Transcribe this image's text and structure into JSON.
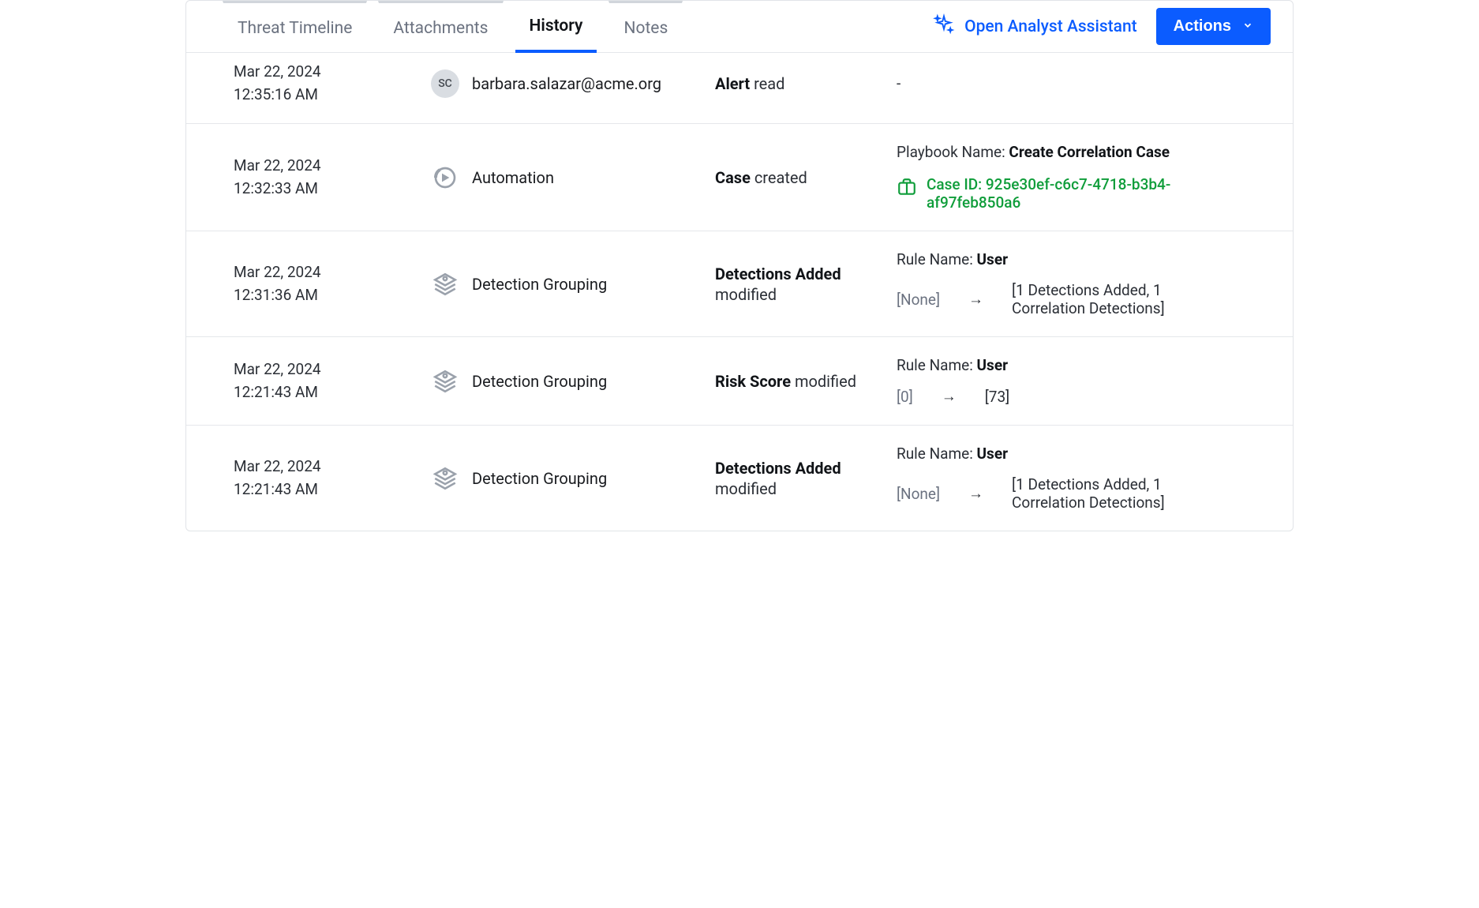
{
  "tabs": {
    "threat_timeline": "Threat Timeline",
    "attachments": "Attachments",
    "history": "History",
    "notes": "Notes"
  },
  "assistant": {
    "label": "Open Analyst Assistant"
  },
  "actions": {
    "label": "Actions"
  },
  "rows": [
    {
      "date": "Mar 22, 2024",
      "time": "12:35:16 AM",
      "actor_type": "user",
      "actor_initials": "SC",
      "actor_name": "barbara.salazar@acme.org",
      "event_bold": "Alert",
      "event_rest": " read",
      "details_type": "dash",
      "dash": "-"
    },
    {
      "date": "Mar 22, 2024",
      "time": "12:32:33 AM",
      "actor_type": "automation",
      "actor_name": "Automation",
      "event_bold": "Case",
      "event_rest": " created",
      "details_type": "case",
      "playbook_label": "Playbook Name: ",
      "playbook_value": "Create Correlation Case",
      "case_id": "Case ID: 925e30ef-c6c7-4718-b3b4-af97feb850a6"
    },
    {
      "date": "Mar 22, 2024",
      "time": "12:31:36 AM",
      "actor_type": "grouping",
      "actor_name": "Detection Grouping",
      "event_bold": "Detections Added",
      "event_rest": " modified",
      "details_type": "change",
      "rule_label": "Rule Name: ",
      "rule_value": "User",
      "from": "[None]",
      "to": "[1 Detections Added, 1 Correlation Detections]"
    },
    {
      "date": "Mar 22, 2024",
      "time": "12:21:43 AM",
      "actor_type": "grouping",
      "actor_name": "Detection Grouping",
      "event_bold": "Risk Score",
      "event_rest": " modified",
      "details_type": "change",
      "rule_label": "Rule Name: ",
      "rule_value": "User",
      "from": "[0]",
      "to": "[73]"
    },
    {
      "date": "Mar 22, 2024",
      "time": "12:21:43 AM",
      "actor_type": "grouping",
      "actor_name": "Detection Grouping",
      "event_bold": "Detections Added",
      "event_rest": " modified",
      "details_type": "change",
      "rule_label": "Rule Name: ",
      "rule_value": "User",
      "from": "[None]",
      "to": "[1 Detections Added, 1 Correlation Detections]"
    }
  ]
}
